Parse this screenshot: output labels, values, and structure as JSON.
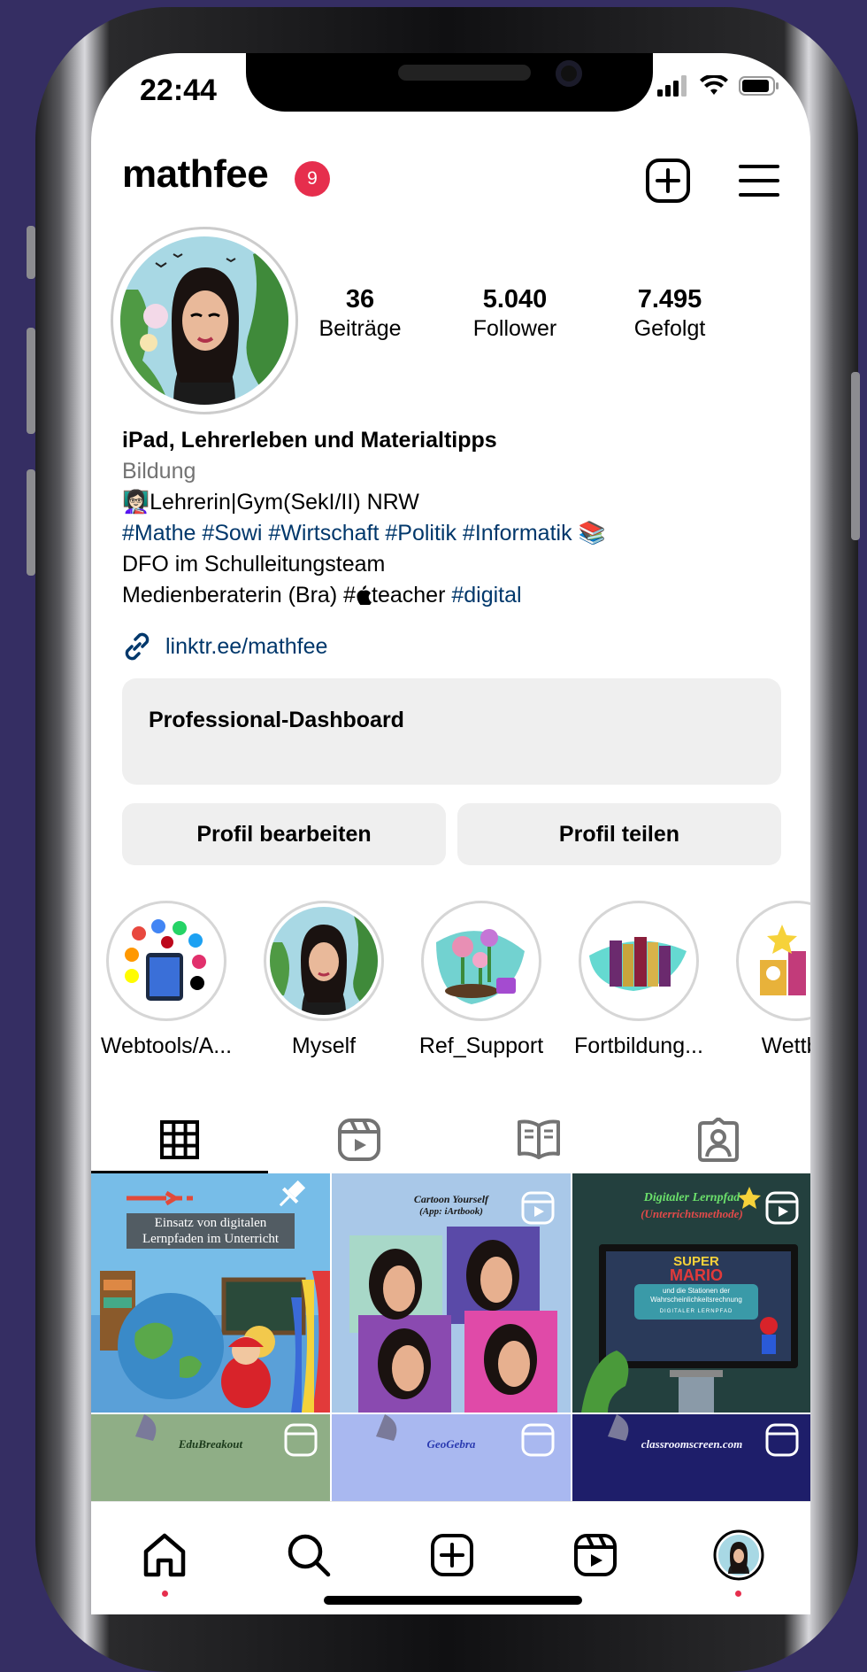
{
  "status": {
    "time": "22:44"
  },
  "header": {
    "username": "mathfee",
    "notification_count": "9"
  },
  "stats": [
    {
      "value": "36",
      "label": "Beiträge"
    },
    {
      "value": "5.040",
      "label": "Follower"
    },
    {
      "value": "7.495",
      "label": "Gefolgt"
    }
  ],
  "bio": {
    "name": "iPad, Lehrerleben und Materialtipps",
    "category": "Bildung",
    "line1": "Lehrerin|Gym(SekI/II) NRW",
    "tags": [
      "#Mathe",
      "#Sowi",
      "#Wirtschaft",
      "#Politik",
      "#Informatik"
    ],
    "line3": "DFO im Schulleitungsteam",
    "line4_prefix": "Medienberaterin (Bra) #",
    "line4_mid": "teacher",
    "line4_tag": "#digital",
    "link": "linktr.ee/mathfee"
  },
  "buttons": {
    "dashboard": "Professional-Dashboard",
    "edit": "Profil bearbeiten",
    "share": "Profil teilen"
  },
  "highlights": [
    {
      "label": "Webtools/A..."
    },
    {
      "label": "Myself"
    },
    {
      "label": "Ref_Support"
    },
    {
      "label": "Fortbildung..."
    },
    {
      "label": "Wettbe"
    }
  ],
  "posts": {
    "p1_title": "Einsatz von digitalen Lernpfaden im Unterricht",
    "p2_title": "Cartoon Yourself",
    "p2_sub": "(App: iArtbook)",
    "p3_title": "Digitaler Lernpfad",
    "p3_sub": "(Unterrichtsmethode)",
    "p3_game_a": "SUPER",
    "p3_game_b": "MARIO",
    "p3_caption": "und die Stationen der Wahrscheinlichkeitsrechnung",
    "p3_strip": "DIGITALER LERNPFAD",
    "p4_title": "EduBreakout",
    "p5_title": "GeoGebra",
    "p6_title": "classroomscreen.com"
  },
  "colors": {
    "accent_red": "#e62e4d",
    "link_blue": "#00376b",
    "button_gray": "#efefef",
    "backdrop": "#352e63"
  }
}
